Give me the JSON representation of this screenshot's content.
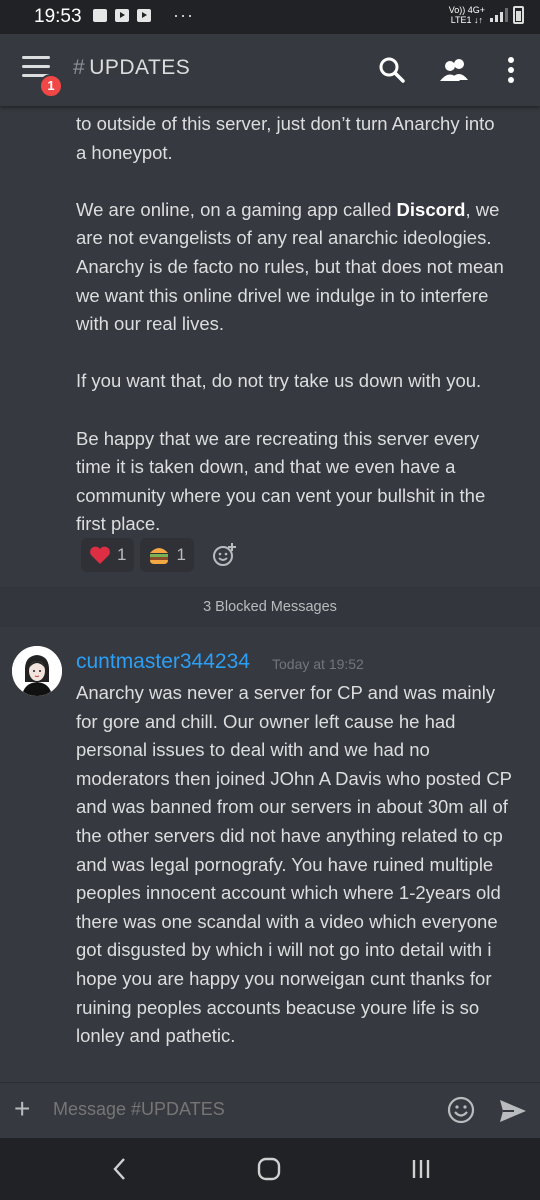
{
  "status_bar": {
    "time": "19:53",
    "dots": "···",
    "network_top": "Vo)) 4G+",
    "network_bottom": "LTE1 ↓↑"
  },
  "header": {
    "hash": "#",
    "channel": "UPDATES",
    "notification_count": "1"
  },
  "messages": {
    "first": {
      "paragraphs": [
        "to outside of this server, just don’t turn Anarchy into\na honeypot.",
        "We are online, on a gaming app called ",
        "Discord",
        ", we\nare not evangelists of any real anarchic ideologies.\nAnarchy is de facto no rules, but that does not mean\nwe want this online drivel we indulge in to interfere\nwith our real lives.",
        "If you want that, do not try take us down with you.",
        "Be happy that we are recreating this server every\ntime it is taken down, and that we even have a\ncommunity where you can vent your bullshit in the\nfirst place."
      ],
      "reactions": [
        {
          "emoji": "heart",
          "count": "1"
        },
        {
          "emoji": "burger",
          "count": "1"
        }
      ]
    },
    "blocked_label": "3 Blocked Messages",
    "second": {
      "username": "cuntmaster344234",
      "timestamp": "Today at 19:52",
      "text": "Anarchy was never a server for CP and was mainly\nfor gore and chill. Our owner left cause he had\npersonal issues to deal with and we had no\nmoderators then joined JOhn A Davis who posted CP\nand was banned from our servers in about 30m all of\nthe other servers did not have anything related to cp\nand was legal pornografy. You have ruined multiple\npeoples innocent account which where 1-2years old\nthere was one scandal with a video which everyone\ngot disgusted by which i will not go into detail with i\nhope you are happy you norweigan cunt thanks for\nruining peoples accounts beacuse youre life is so\nlonley and pathetic."
    }
  },
  "input": {
    "placeholder": "Message #UPDATES"
  }
}
